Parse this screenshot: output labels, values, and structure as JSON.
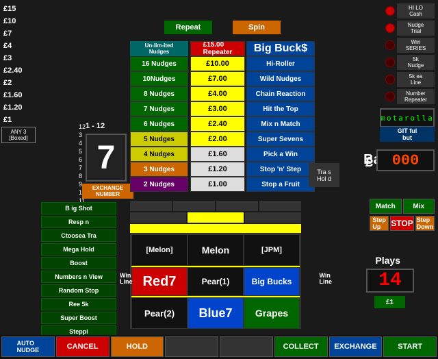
{
  "prizes": {
    "items": [
      "£15",
      "£10",
      "£7",
      "£4",
      "£3",
      "£2.40",
      "£2",
      "£1.60",
      "£1.20",
      "£1"
    ],
    "any3": "ANY 3\n[Boxed]"
  },
  "range": {
    "label": "1 - 12",
    "number": "7"
  },
  "nudge_options": {
    "header": "Un-lim-ited\nNudges",
    "rows": [
      {
        "label": "16 Nudges",
        "color": "green"
      },
      {
        "label": "10Nudges",
        "color": "green"
      },
      {
        "label": "8 Nudges",
        "color": "green"
      },
      {
        "label": "7 Nudges",
        "color": "green"
      },
      {
        "label": "6 Nudges",
        "color": "green"
      },
      {
        "label": "5 Nudges",
        "color": "yellow"
      },
      {
        "label": "4 Nudges",
        "color": "yellow"
      },
      {
        "label": "3 Nudges",
        "color": "orange"
      },
      {
        "label": "2 Nudges",
        "color": "purple"
      }
    ]
  },
  "values": {
    "top": "£15.00\nRepeater",
    "rows": [
      "£10.00",
      "£7.00",
      "£4.00",
      "£3.00",
      "£2.40",
      "£2.00",
      "£1.60",
      "£1.20",
      "£1.00"
    ]
  },
  "features": {
    "top": "Big Buck$",
    "rows": [
      "Hi-Roller",
      "Wild Nudges",
      "Chain Reaction",
      "Hit the Top",
      "Mix n Match",
      "Super Sevens",
      "Pick a Win",
      "Stop 'n' Step",
      "Stop a Fruit"
    ]
  },
  "lights": {
    "items": [
      {
        "label": "HI LO\nCash"
      },
      {
        "label": "Nudge\nTrial"
      },
      {
        "label": "Win\nSERIES"
      },
      {
        "label": "5k\nNudge"
      },
      {
        "label": "5k ea\nLine"
      },
      {
        "label": "Number\nRepeater"
      }
    ]
  },
  "motorola": {
    "text": "motarolla"
  },
  "git_display": {
    "text": "GIT ful\nbut"
  },
  "bank": {
    "label": "Bank",
    "symbol": "£",
    "value": "000"
  },
  "plays": {
    "label": "Plays",
    "value": "14",
    "coin": "£1"
  },
  "buttons": {
    "repeat": "Repeat",
    "spin": "Spin",
    "exchange_number": "EXCHANGE\nNUMBER"
  },
  "action_buttons": [
    "B ig Shot",
    "Resp n",
    "Ctoosea Tra",
    "Mega Hold",
    "Boost",
    "Numbers n View",
    "Random Stop",
    "Ree 5k",
    "Super Boost",
    "Steppi"
  ],
  "reels": {
    "row1": [
      "[Melon]",
      "Melon",
      "[JPM]"
    ],
    "row2": [
      "Red7",
      "Pear(1)",
      "Big Bucks"
    ],
    "row3": [
      "Pear(2)",
      "Blue7",
      "Grapes"
    ]
  },
  "mid_buttons": {
    "match": "Match",
    "mix": "Mix",
    "step_up": "Step\nUp",
    "stop": "STOP",
    "step_down": "Step\nDown"
  },
  "transfer_hold": {
    "line1": "Tra s",
    "line2": "Hol d"
  },
  "bottom_buttons": [
    {
      "label": "AUTO\nNUDGE",
      "style": "auto-nudge"
    },
    {
      "label": "CANCEL",
      "style": "cancel"
    },
    {
      "label": "HOLD",
      "style": "hold"
    },
    {
      "label": "",
      "style": "inactive"
    },
    {
      "label": "",
      "style": "inactive"
    },
    {
      "label": "COLLECT",
      "style": "collect"
    },
    {
      "label": "EXCHANGE",
      "style": "exchange"
    },
    {
      "label": "START",
      "style": "start"
    }
  ],
  "indicators": {
    "row1": [
      "",
      "",
      "",
      ""
    ],
    "row2": [
      "",
      "",
      ""
    ],
    "row3": [
      ""
    ]
  }
}
